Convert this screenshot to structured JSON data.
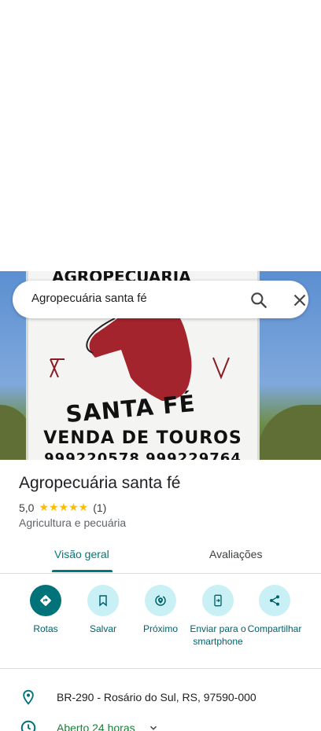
{
  "search": {
    "query": "Agropecuária santa fé"
  },
  "photo": {
    "sign_line1": "SANTA FÉ",
    "sign_line2": "VENDA DE TOUROS",
    "sign_line3": "999220578     999229764"
  },
  "place": {
    "name": "Agropecuária santa fé",
    "rating": "5,0",
    "stars": "★★★★★",
    "review_count": "(1)",
    "category": "Agricultura e pecuária"
  },
  "tabs": [
    {
      "label": "Visão geral",
      "active": true
    },
    {
      "label": "Avaliações",
      "active": false
    }
  ],
  "actions": [
    {
      "label": "Rotas",
      "icon": "directions-icon"
    },
    {
      "label": "Salvar",
      "icon": "bookmark-icon"
    },
    {
      "label": "Próximo",
      "icon": "nearby-icon"
    },
    {
      "label": "Enviar para o smartphone",
      "icon": "send-to-phone-icon"
    },
    {
      "label": "Compartilhar",
      "icon": "share-icon"
    }
  ],
  "details": {
    "address": "BR-290 - Rosário do Sul, RS, 97590-000",
    "hours": "Aberto 24 horas"
  },
  "colors": {
    "accent": "#00797a",
    "star": "#fbbc04",
    "open": "#188038"
  }
}
